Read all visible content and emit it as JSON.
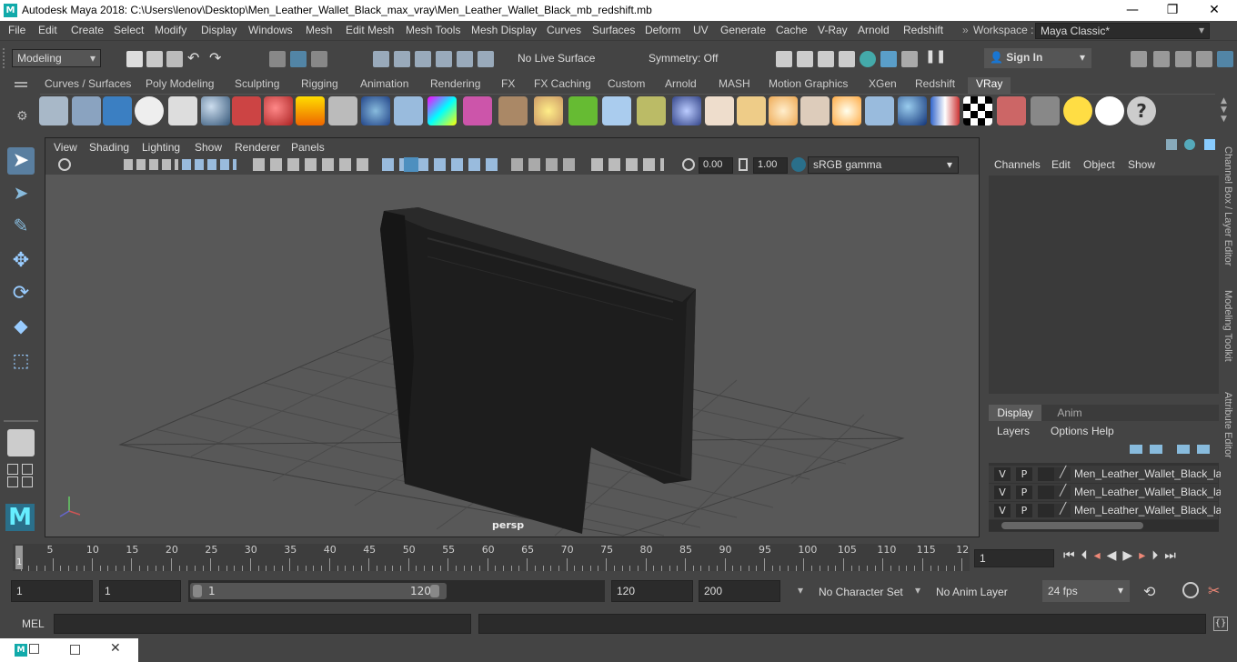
{
  "window": {
    "title": "Autodesk Maya 2018: C:\\Users\\lenov\\Desktop\\Men_Leather_Wallet_Black_max_vray\\Men_Leather_Wallet_Black_mb_redshift.mb",
    "minimize": "—",
    "maximize": "❐",
    "close": "✕",
    "app_logo": "M"
  },
  "menubar": [
    "File",
    "Edit",
    "Create",
    "Select",
    "Modify",
    "Display",
    "Windows",
    "Mesh",
    "Edit Mesh",
    "Mesh Tools",
    "Mesh Display",
    "Curves",
    "Surfaces",
    "Deform",
    "UV",
    "Generate",
    "Cache",
    "V-Ray",
    "Arnold",
    "Redshift"
  ],
  "workspace": {
    "label": "Workspace :",
    "value": "Maya Classic*"
  },
  "statusline": {
    "mode": "Modeling",
    "live_surface": "No Live Surface",
    "symmetry": "Symmetry: Off",
    "sign_in": "Sign In"
  },
  "shelf": {
    "tabs": [
      "Curves / Surfaces",
      "Poly Modeling",
      "Sculpting",
      "Rigging",
      "Animation",
      "Rendering",
      "FX",
      "FX Caching",
      "Custom",
      "Arnold",
      "MASH",
      "Motion Graphics",
      "XGen",
      "Redshift",
      "VRay"
    ],
    "active_tab": "VRay"
  },
  "panel": {
    "menus": [
      "View",
      "Shading",
      "Lighting",
      "Show",
      "Renderer",
      "Panels"
    ],
    "exposure": "0.00",
    "gamma": "1.00",
    "color_space": "sRGB gamma",
    "camera_label": "persp"
  },
  "channel_box": {
    "menus": [
      "Channels",
      "Edit",
      "Object",
      "Show"
    ],
    "side_tabs": [
      "Channel Box / Layer Editor",
      "Modeling Toolkit",
      "Attribute Editor"
    ]
  },
  "layer_editor": {
    "tabs": [
      "Display",
      "Anim"
    ],
    "menus": [
      "Layers",
      "Options",
      "Help"
    ],
    "layers": [
      {
        "v": "V",
        "p": "P",
        "name": "Men_Leather_Wallet_Black_lay"
      },
      {
        "v": "V",
        "p": "P",
        "name": "Men_Leather_Wallet_Black_lay"
      },
      {
        "v": "V",
        "p": "P",
        "name": "Men_Leather_Wallet_Black_lay"
      }
    ]
  },
  "timeline": {
    "ticks": [
      "5",
      "10",
      "15",
      "20",
      "25",
      "30",
      "35",
      "40",
      "45",
      "50",
      "55",
      "60",
      "65",
      "70",
      "75",
      "80",
      "85",
      "90",
      "95",
      "100",
      "105",
      "110",
      "115",
      "12"
    ],
    "start_marker": "1",
    "current_frame": "1"
  },
  "range": {
    "start": "1",
    "anim_start": "1",
    "slider_start": "1",
    "slider_end": "120",
    "end": "120",
    "anim_end": "200",
    "character_set": "No Character Set",
    "anim_layer": "No Anim Layer",
    "fps": "24 fps"
  },
  "cmdline": {
    "label": "MEL"
  },
  "colors": {
    "bg": "#444444",
    "field": "#2b2b2b",
    "viewport": "#585858",
    "accent": "#5285a6"
  }
}
